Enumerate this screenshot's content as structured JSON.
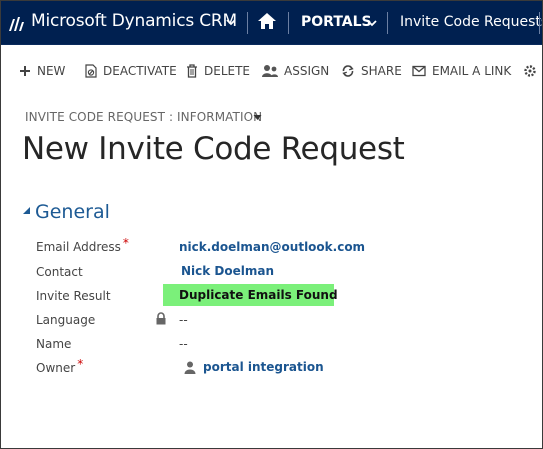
{
  "nav": {
    "brand": "Microsoft Dynamics CRM",
    "area": "PORTALS",
    "entity": "Invite Code Requests"
  },
  "commands": [
    {
      "label": "NEW",
      "icon": "plus-icon"
    },
    {
      "label": "DEACTIVATE",
      "icon": "deactivate-icon"
    },
    {
      "label": "DELETE",
      "icon": "trash-icon"
    },
    {
      "label": "ASSIGN",
      "icon": "assign-icon"
    },
    {
      "label": "SHARE",
      "icon": "share-icon"
    },
    {
      "label": "EMAIL A LINK",
      "icon": "envelope-icon"
    }
  ],
  "form": {
    "selector": "INVITE CODE REQUEST : INFORMATION",
    "title": "New Invite Code Request"
  },
  "section": {
    "title": "General",
    "fields": [
      {
        "label": "Email Address",
        "required": "*",
        "value": "nick.doelman@outlook.com"
      },
      {
        "label": "Contact",
        "value": "Nick Doelman"
      },
      {
        "label": "Invite Result",
        "value": "Duplicate Emails Found"
      },
      {
        "label": "Language",
        "value": "--"
      },
      {
        "label": "Name",
        "value": "--"
      },
      {
        "label": "Owner",
        "required": "*",
        "value": "portal integration"
      }
    ]
  },
  "colors": {
    "nav_bg": "#002050",
    "link": "#1b5590",
    "section_title": "#1d5a94",
    "highlight": "#7bf07a",
    "required": "#cc0000"
  }
}
